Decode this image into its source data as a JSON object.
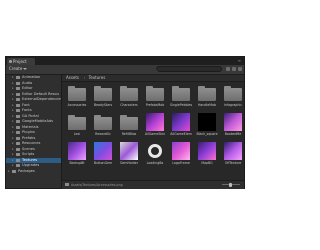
{
  "window": {
    "tab_title": "Project",
    "create_label": "Create"
  },
  "search": {
    "placeholder": ""
  },
  "sidebar": {
    "items": [
      {
        "label": "Animation",
        "indent": 2,
        "selected": false
      },
      {
        "label": "Audio",
        "indent": 2,
        "selected": false
      },
      {
        "label": "Editor",
        "indent": 2,
        "selected": false
      },
      {
        "label": "Editor Default Resou",
        "indent": 2,
        "selected": false
      },
      {
        "label": "ExternalDependencies",
        "indent": 2,
        "selected": false
      },
      {
        "label": "Font",
        "indent": 2,
        "selected": false
      },
      {
        "label": "Fonts",
        "indent": 2,
        "selected": false
      },
      {
        "label": "GA Portal",
        "indent": 2,
        "selected": false
      },
      {
        "label": "GoogleMobileAds",
        "indent": 2,
        "selected": false
      },
      {
        "label": "Materials",
        "indent": 2,
        "selected": false
      },
      {
        "label": "Plugins",
        "indent": 2,
        "selected": false
      },
      {
        "label": "Prefabs",
        "indent": 2,
        "selected": false
      },
      {
        "label": "Resources",
        "indent": 2,
        "selected": false
      },
      {
        "label": "Scenes",
        "indent": 2,
        "selected": false
      },
      {
        "label": "Scripts",
        "indent": 2,
        "selected": false
      },
      {
        "label": "Textures",
        "indent": 2,
        "selected": true
      },
      {
        "label": "Upgrades",
        "indent": 2,
        "selected": false
      },
      {
        "label": "Packages",
        "indent": 0,
        "selected": false
      }
    ]
  },
  "breadcrumb": [
    "Assets",
    "Textures"
  ],
  "assets": [
    {
      "name": "Accessories",
      "type": "folder"
    },
    {
      "name": "BeadyStars",
      "type": "folder"
    },
    {
      "name": "Characters",
      "type": "folder"
    },
    {
      "name": "PrefabsMob",
      "type": "folder"
    },
    {
      "name": "SinglePebbles",
      "type": "folder"
    },
    {
      "name": "HandleMob",
      "type": "folder"
    },
    {
      "name": "Infographic",
      "type": "folder"
    },
    {
      "name": "Lexi",
      "type": "folder"
    },
    {
      "name": "RewardSc",
      "type": "folder"
    },
    {
      "name": "RefillBlox",
      "type": "folder"
    },
    {
      "name": "AllGameSkin",
      "type": "image",
      "colors": [
        "#3a1b6b",
        "#b23fd6",
        "#ff7bd1"
      ]
    },
    {
      "name": "AllGameElem",
      "type": "image",
      "colors": [
        "#2c1c5e",
        "#7a39c8",
        "#e44ad6"
      ]
    },
    {
      "name": "Black_square",
      "type": "image",
      "colors": [
        "#000000",
        "#000000",
        "#000000"
      ]
    },
    {
      "name": "BookedMe",
      "type": "image",
      "colors": [
        "#3d1f78",
        "#c05bd8",
        "#ff9ae0"
      ]
    },
    {
      "name": "BackupBt",
      "type": "image",
      "colors": [
        "#4b2a8a",
        "#a04fe0",
        "#f0a3ff"
      ]
    },
    {
      "name": "ButtonGem",
      "type": "image",
      "colors": [
        "#2a7ad8",
        "#7b4ee0",
        "#d24fd9"
      ]
    },
    {
      "name": "GemHolder",
      "type": "image",
      "colors": [
        "#d8d8d8",
        "#9c5ad6",
        "#ffffff"
      ]
    },
    {
      "name": "LoadingBa",
      "type": "ring",
      "colors": [
        "#e8e8e8",
        "#ffffff",
        "#282828"
      ]
    },
    {
      "name": "LogoFrame",
      "type": "image",
      "colors": [
        "#8a3fd0",
        "#e05ad5",
        "#ffb5f0"
      ]
    },
    {
      "name": "MapBG",
      "type": "image",
      "colors": [
        "#3a1c72",
        "#8d3fd8",
        "#ff6fd0"
      ]
    },
    {
      "name": "OffTexture",
      "type": "image",
      "colors": [
        "#2e1d6a",
        "#b45ce8",
        "#f9a0ff"
      ]
    }
  ],
  "status": {
    "path": "Assets/Textures/Accessories.png"
  }
}
